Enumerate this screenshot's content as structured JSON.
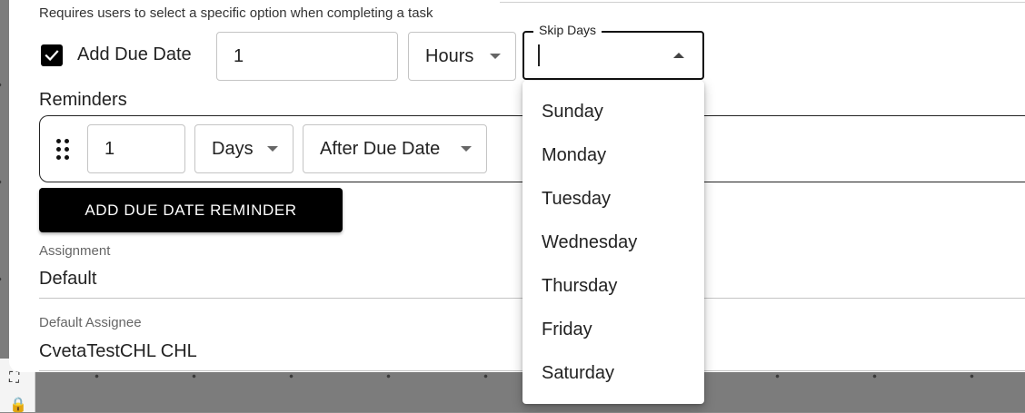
{
  "description": "Requires users to select a specific option when completing a task",
  "due_date": {
    "checkbox_label": "Add Due Date",
    "checked": true,
    "amount": "1",
    "unit": "Hours"
  },
  "skip_days": {
    "label": "Skip Days",
    "value": "",
    "options": [
      "Sunday",
      "Monday",
      "Tuesday",
      "Wednesday",
      "Thursday",
      "Friday",
      "Saturday"
    ]
  },
  "reminders": {
    "label": "Reminders",
    "items": [
      {
        "amount": "1",
        "unit": "Days",
        "relation": "After Due Date"
      }
    ],
    "add_button_label": "ADD DUE DATE REMINDER"
  },
  "assignment": {
    "label": "Assignment",
    "value": "Default"
  },
  "default_assignee": {
    "label": "Default Assignee",
    "value": "CvetaTestCHL CHL"
  },
  "icons": {
    "checkbox": "check-icon",
    "drag": "drag-handle-icon",
    "dropdown": "caret-down-icon",
    "dropdown_open": "caret-up-icon",
    "canvas_fit": "fit-screen-icon",
    "canvas_lock": "lock-icon"
  },
  "colors": {
    "primary": "#000000",
    "border": "#c4c4c4",
    "canvas": "#7c7c7c"
  }
}
